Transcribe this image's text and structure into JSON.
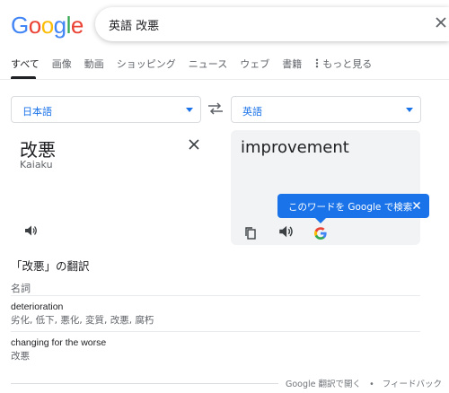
{
  "header": {
    "logo": {
      "letters": [
        "G",
        "o",
        "o",
        "g",
        "l",
        "e"
      ],
      "colors": [
        "#4285F4",
        "#EA4335",
        "#FBBC05",
        "#4285F4",
        "#34A853",
        "#EA4335"
      ]
    },
    "search": {
      "value": "英語 改悪",
      "clear_icon": "close-icon"
    }
  },
  "tabs": {
    "items": [
      "すべて",
      "画像",
      "動画",
      "ショッピング",
      "ニュース",
      "ウェブ",
      "書籍",
      "もっと見る"
    ],
    "active_index": 0,
    "more_icon": "vertical-dots-icon"
  },
  "translator": {
    "source_lang": "日本語",
    "target_lang": "英語",
    "swap_icon": "swap-arrows-icon",
    "source_text": "改悪",
    "source_romaji": "Kaiaku",
    "target_text": "improvement",
    "tooltip": "このワードを Google で検索"
  },
  "translations": {
    "title": "「改悪」の翻訳",
    "part_of_speech": "名詞",
    "entries": [
      {
        "word": "deterioration",
        "synonyms": "劣化, 低下, 悪化, 変質, 改悪, 腐朽"
      },
      {
        "word": "changing for the worse",
        "synonyms": "改悪"
      }
    ]
  },
  "footer": {
    "open": "Google 翻訳で開く",
    "bullet": "•",
    "feedback": "フィードバック"
  },
  "colors": {
    "accent": "#1a73e8",
    "panel_bg": "#f1f3f4"
  }
}
